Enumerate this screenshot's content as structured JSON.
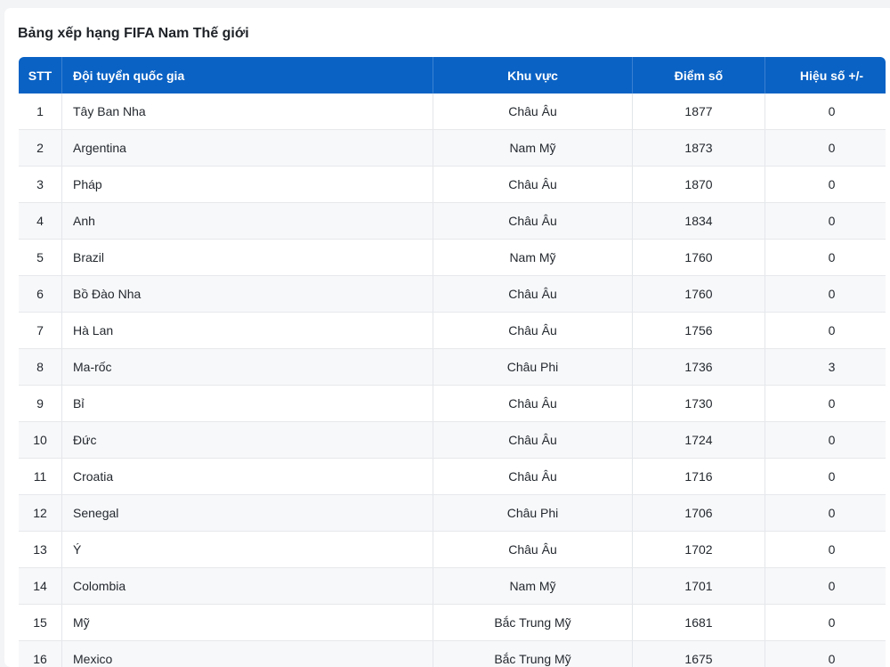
{
  "title": "Bảng xếp hạng FIFA Nam Thế giới",
  "table": {
    "headers": [
      "STT",
      "Đội tuyển quốc gia",
      "Khu vực",
      "Điểm số",
      "Hiệu số +/-"
    ],
    "rows": [
      [
        "1",
        "Tây Ban Nha",
        "Châu Âu",
        "1877",
        "0"
      ],
      [
        "2",
        "Argentina",
        "Nam Mỹ",
        "1873",
        "0"
      ],
      [
        "3",
        "Pháp",
        "Châu Âu",
        "1870",
        "0"
      ],
      [
        "4",
        "Anh",
        "Châu Âu",
        "1834",
        "0"
      ],
      [
        "5",
        "Brazil",
        "Nam Mỹ",
        "1760",
        "0"
      ],
      [
        "6",
        "Bồ Đào Nha",
        "Châu Âu",
        "1760",
        "0"
      ],
      [
        "7",
        "Hà Lan",
        "Châu Âu",
        "1756",
        "0"
      ],
      [
        "8",
        "Ma-rốc",
        "Châu Phi",
        "1736",
        "3"
      ],
      [
        "9",
        "Bỉ",
        "Châu Âu",
        "1730",
        "0"
      ],
      [
        "10",
        "Đức",
        "Châu Âu",
        "1724",
        "0"
      ],
      [
        "11",
        "Croatia",
        "Châu Âu",
        "1716",
        "0"
      ],
      [
        "12",
        "Senegal",
        "Châu Phi",
        "1706",
        "0"
      ],
      [
        "13",
        "Ý",
        "Châu Âu",
        "1702",
        "0"
      ],
      [
        "14",
        "Colombia",
        "Nam Mỹ",
        "1701",
        "0"
      ],
      [
        "15",
        "Mỹ",
        "Bắc Trung Mỹ",
        "1681",
        "0"
      ],
      [
        "16",
        "Mexico",
        "Bắc Trung Mỹ",
        "1675",
        "0"
      ]
    ]
  }
}
